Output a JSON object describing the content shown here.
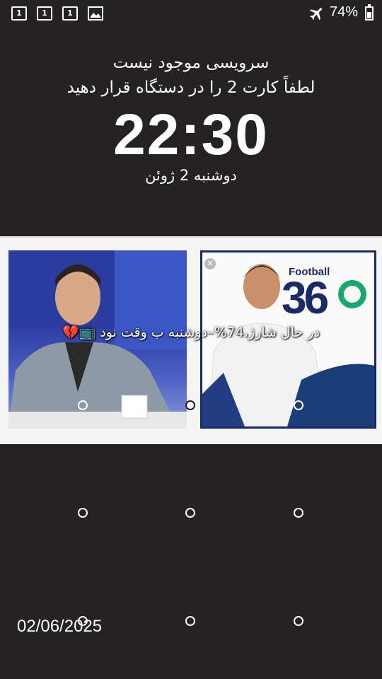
{
  "status_bar": {
    "sim_icon_label": "1",
    "battery_percent": "74%",
    "icons": [
      "sim-1-icon",
      "sim-1-icon",
      "sim-1-icon",
      "image-icon",
      "airplane-icon",
      "battery-charging-icon"
    ]
  },
  "lock": {
    "service_line1": "سرویسی موجود نیست",
    "service_line2": "لطفاً کارت 2 را در دستگاه قرار دهید",
    "time": "22:30",
    "date": "دوشنبه 2 ژوئن"
  },
  "media": {
    "logo_word": "Football",
    "logo_number": "36",
    "notification": "در حال شارژ،74%–دوشنبه ب وقت نود 📺💔"
  },
  "footer": {
    "date": "02/06/2025"
  },
  "colors": {
    "background": "#242223",
    "panel": "#f5f5f5",
    "logo_blue": "#1a2a66",
    "logo_green": "#19a86b"
  }
}
